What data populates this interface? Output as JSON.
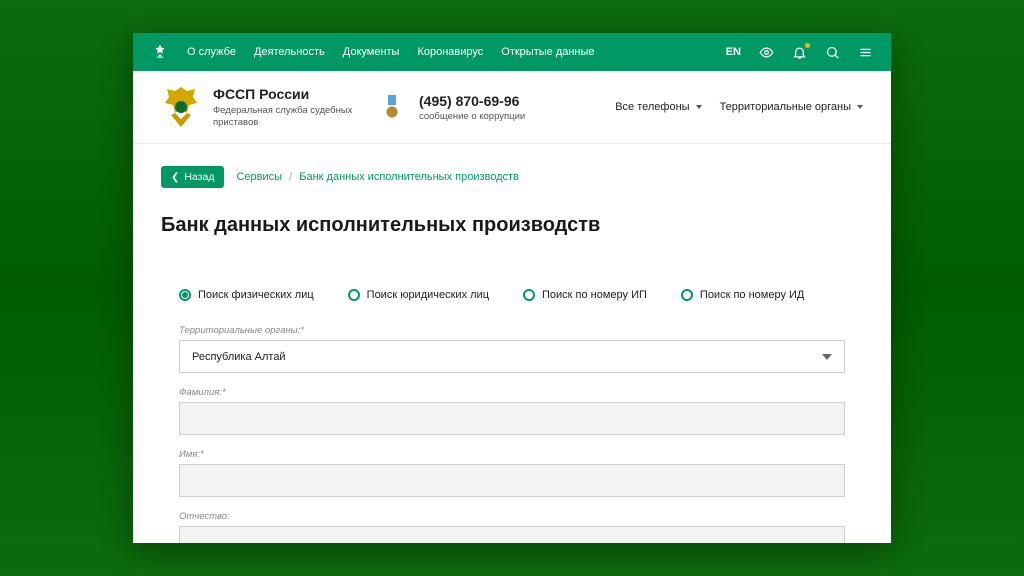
{
  "topbar": {
    "nav": [
      "О службе",
      "Деятельность",
      "Документы",
      "Коронавирус",
      "Открытые данные"
    ],
    "lang": "EN"
  },
  "header": {
    "org_title": "ФССП России",
    "org_sub": "Федеральная служба судебных приставов",
    "phone": "(495) 870-69-96",
    "phone_hint": "сообщение о коррупции",
    "dd_phones": "Все телефоны",
    "dd_territories": "Территориальные органы"
  },
  "crumbs": {
    "back": "Назад",
    "root": "Сервисы",
    "current": "Банк данных исполнительных производств"
  },
  "page": {
    "title": "Банк данных исполнительных производств"
  },
  "search": {
    "tabs": [
      "Поиск физических лиц",
      "Поиск юридических лиц",
      "Поиск по номеру ИП",
      "Поиск по номеру ИД"
    ],
    "active_tab": 0,
    "fields": {
      "territory_label": "Территориальные органы:*",
      "territory_value": "Республика Алтай",
      "lastname_label": "Фамилия:*",
      "lastname_value": "",
      "firstname_label": "Имя:*",
      "firstname_value": "",
      "patronymic_label": "Отчество:",
      "patronymic_value": ""
    }
  }
}
